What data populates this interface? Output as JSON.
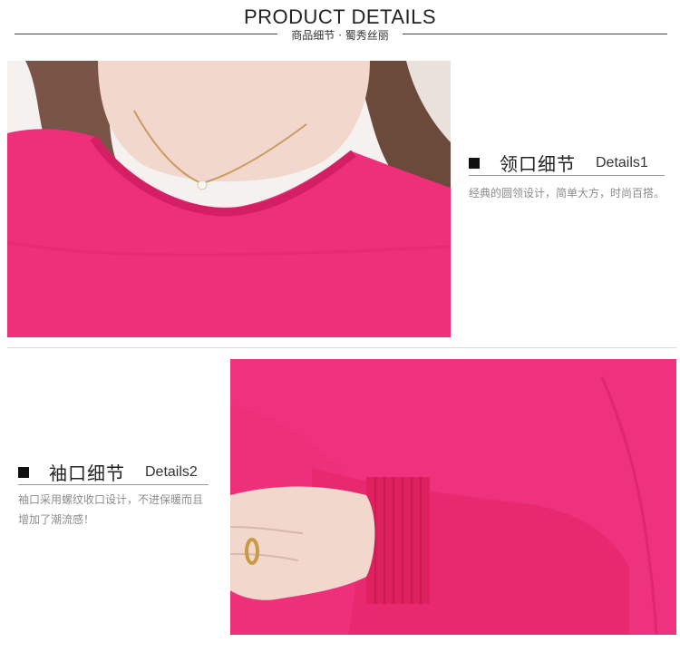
{
  "header": {
    "title": "PRODUCT DETAILS",
    "subtitle": "商品细节 · 蜀秀丝丽"
  },
  "details": [
    {
      "name": "领口细节",
      "label": "Details1",
      "description": "经典的圆领设计，简单大方，时尚百搭。"
    },
    {
      "name": "袖口细节",
      "label": "Details2",
      "description": "袖口采用螺纹收口设计，不进保暖而且增加了潮流感！"
    }
  ],
  "colors": {
    "sweater": "#ee2f7a",
    "sweater_shadow": "#d41f65",
    "skin": "#f1d7cc",
    "hair": "#6b4a3c",
    "background": "#ffffff"
  }
}
